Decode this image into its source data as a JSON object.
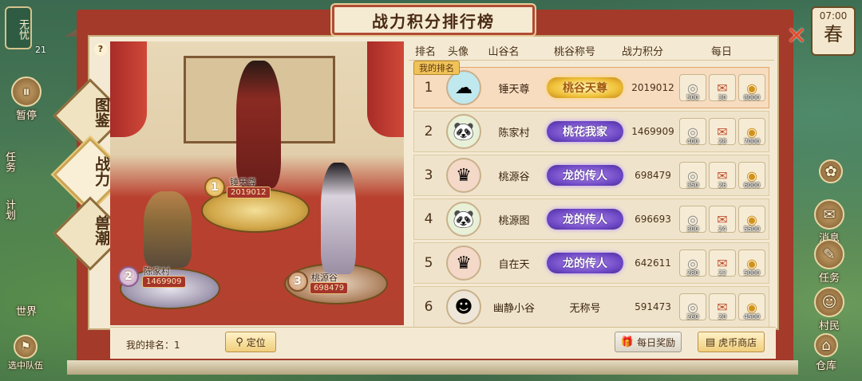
{
  "title": "战力积分排行榜",
  "clock": {
    "time": "07:00",
    "season": "春"
  },
  "status": {
    "badge": "无忧",
    "count": "21"
  },
  "left_menu": [
    {
      "label": "暂停"
    },
    {
      "label": "任务"
    },
    {
      "label": "计划"
    },
    {
      "label": "世界"
    },
    {
      "label": "选中队伍"
    }
  ],
  "right_menu": [
    {
      "label": "消息"
    },
    {
      "label": "任务"
    },
    {
      "label": "村民"
    },
    {
      "label": "仓库"
    }
  ],
  "tabs": [
    {
      "label": "图鉴",
      "active": false
    },
    {
      "label": "战力",
      "active": true
    },
    {
      "label": "兽潮",
      "active": false
    }
  ],
  "podium": [
    {
      "rank": "1",
      "name": "锤天尊",
      "score": "2019012"
    },
    {
      "rank": "2",
      "name": "陈家村",
      "score": "1469909"
    },
    {
      "rank": "3",
      "name": "桃源谷",
      "score": "698479"
    }
  ],
  "table": {
    "headers": [
      "排名",
      "头像",
      "山谷名",
      "桃谷称号",
      "战力积分",
      "每日"
    ],
    "my_rank_tag": "我的排名",
    "rows": [
      {
        "rank": "1",
        "avatar": "blue-spirit",
        "name": "锤天尊",
        "title": "桃谷天尊",
        "title_style": "gold",
        "score": "2019012",
        "rewards": [
          "500",
          "30",
          "8000"
        ],
        "mine": true
      },
      {
        "rank": "2",
        "avatar": "panda",
        "name": "陈家村",
        "title": "桃花我家",
        "title_style": "purple",
        "score": "1469909",
        "rewards": [
          "400",
          "28",
          "7000"
        ],
        "mine": false
      },
      {
        "rank": "3",
        "avatar": "red-girl",
        "name": "桃源谷",
        "title": "龙的传人",
        "title_style": "purple",
        "score": "698479",
        "rewards": [
          "350",
          "26",
          "6000"
        ],
        "mine": false
      },
      {
        "rank": "4",
        "avatar": "panda",
        "name": "桃源图",
        "title": "龙的传人",
        "title_style": "purple",
        "score": "696693",
        "rewards": [
          "300",
          "24",
          "5500"
        ],
        "mine": false
      },
      {
        "rank": "5",
        "avatar": "red-girl",
        "name": "自在天",
        "title": "龙的传人",
        "title_style": "purple",
        "score": "642611",
        "rewards": [
          "280",
          "22",
          "5000"
        ],
        "mine": false
      },
      {
        "rank": "6",
        "avatar": "black-hair",
        "name": "幽静小谷",
        "title": "无称号",
        "title_style": "plain",
        "score": "591473",
        "rewards": [
          "260",
          "20",
          "4500"
        ],
        "mine": false
      }
    ]
  },
  "bottom": {
    "my_rank_label": "我的排名：1",
    "locate": "定位",
    "daily_reward": "每日奖励",
    "shop": "虎币商店"
  },
  "colors": {
    "frame_red": "#a33a2a",
    "parchment": "#f4ead4",
    "gold": "#f0c35a",
    "purple_title": "#6a45c2"
  }
}
